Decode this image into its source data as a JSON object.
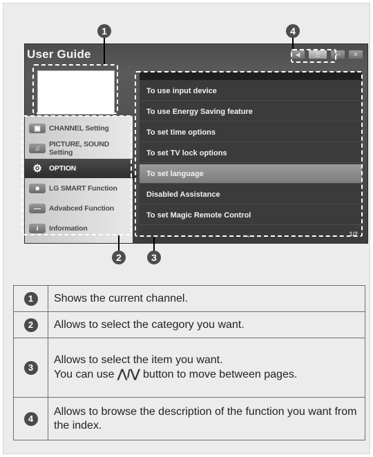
{
  "screen": {
    "title": "User Guide",
    "categories": [
      {
        "label": "CHANNEL Setting",
        "selected": false
      },
      {
        "label": "PICTURE, SOUND Setting",
        "selected": false
      },
      {
        "label": "OPTION",
        "selected": true,
        "icon": "gear-icon"
      },
      {
        "label": "LG SMART Function",
        "selected": false
      },
      {
        "label": "Advabced Function",
        "selected": false
      },
      {
        "label": "Information",
        "selected": false
      }
    ],
    "items": [
      {
        "label": "To use input device",
        "selected": false
      },
      {
        "label": "To use Energy Saving feature",
        "selected": false
      },
      {
        "label": "To set time options",
        "selected": false
      },
      {
        "label": "To set TV lock options",
        "selected": false
      },
      {
        "label": "To set language",
        "selected": true
      },
      {
        "label": "Disabled Assistance",
        "selected": false
      },
      {
        "label": "To set Magic Remote Control",
        "selected": false
      }
    ],
    "page_indicator": "1/2"
  },
  "callouts": {
    "one": "1",
    "two": "2",
    "three": "3",
    "four": "4"
  },
  "legend": {
    "rows": [
      {
        "num": "1",
        "text": "Shows the current channel."
      },
      {
        "num": "2",
        "text": "Allows to select the category you want."
      },
      {
        "num": "3",
        "text_line1": "Allows to select the item you want.",
        "text_line2a": "You can use",
        "text_line2b": "button to move between pages."
      },
      {
        "num": "4",
        "text": "Allows to browse the description of the function you want from the index."
      }
    ]
  },
  "colors": {
    "frame_bg": "#ececec",
    "tv_bg": "#4d4d4d",
    "selected_category": "#2e2e2e",
    "selected_item": "#8c8c8c",
    "callout_dash": "#ffffff",
    "badge": "#4d4d4d"
  }
}
